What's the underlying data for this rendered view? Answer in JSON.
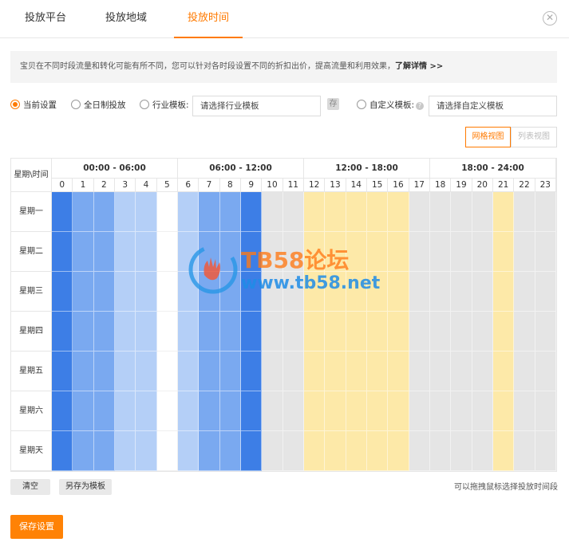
{
  "tabs": [
    {
      "label": "投放平台",
      "active": false
    },
    {
      "label": "投放地域",
      "active": false
    },
    {
      "label": "投放时间",
      "active": true
    }
  ],
  "close_icon": "close-circle-icon",
  "info": {
    "text": "宝贝在不同时段流量和转化可能有所不同，您可以针对各时段设置不同的折扣出价，提高流量和利用效果，",
    "link": "了解详情 >>"
  },
  "options": {
    "current": "当前设置",
    "all_day": "全日制投放",
    "industry": "行业模板:",
    "industry_placeholder": "请选择行业模板",
    "save_icon_glyph": "存",
    "custom": "自定义模板:",
    "help_glyph": "?",
    "custom_placeholder": "请选择自定义模板",
    "selected": "current"
  },
  "views": {
    "grid": "网格视图",
    "list": "列表视图",
    "active": "grid"
  },
  "grid": {
    "corner": "星期\\时间",
    "ranges": [
      "00:00 - 06:00",
      "06:00 - 12:00",
      "12:00 - 18:00",
      "18:00 - 24:00"
    ],
    "hours": [
      "0",
      "1",
      "2",
      "3",
      "4",
      "5",
      "6",
      "7",
      "8",
      "9",
      "10",
      "11",
      "12",
      "13",
      "14",
      "15",
      "16",
      "17",
      "18",
      "19",
      "20",
      "21",
      "22",
      "23"
    ],
    "days": [
      "星期一",
      "星期二",
      "星期三",
      "星期四",
      "星期五",
      "星期六",
      "星期天"
    ],
    "hour_levels": [
      "dark",
      "mid",
      "mid",
      "light",
      "light",
      "none",
      "light",
      "mid",
      "mid",
      "dark",
      "gray",
      "gray",
      "yellow",
      "yellow",
      "yellow",
      "yellow",
      "yellow",
      "gray",
      "gray",
      "gray",
      "gray",
      "yellow",
      "gray",
      "gray"
    ],
    "colors": {
      "dark": "#3d7ee6",
      "mid": "#7aa9f0",
      "light": "#b4cff7",
      "none": "#ffffff",
      "gray": "#e5e5e5",
      "yellow": "#fde9a8"
    }
  },
  "watermark": {
    "title": "TB58论坛",
    "url": "www.tb58.net"
  },
  "buttons": {
    "clear": "清空",
    "save_template": "另存为模板",
    "save": "保存设置"
  },
  "hint": "可以拖拽鼠标选择投放时间段"
}
